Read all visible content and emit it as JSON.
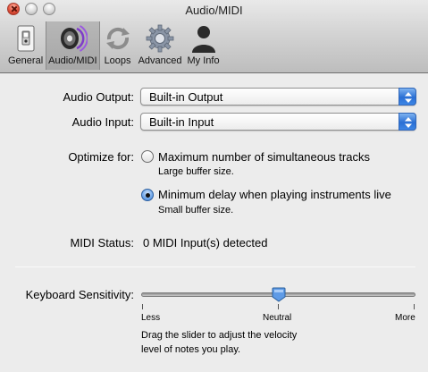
{
  "window": {
    "title": "Audio/MIDI"
  },
  "toolbar": {
    "items": [
      {
        "label": "General",
        "icon": "switch-icon",
        "selected": false
      },
      {
        "label": "Audio/MIDI",
        "icon": "speaker-icon",
        "selected": true
      },
      {
        "label": "Loops",
        "icon": "loops-icon",
        "selected": false
      },
      {
        "label": "Advanced",
        "icon": "gear-icon",
        "selected": false
      },
      {
        "label": "My Info",
        "icon": "person-icon",
        "selected": false
      }
    ]
  },
  "audio": {
    "output_label": "Audio Output:",
    "output_value": "Built-in Output",
    "input_label": "Audio Input:",
    "input_value": "Built-in Input"
  },
  "optimize": {
    "label": "Optimize for:",
    "options": [
      {
        "title": "Maximum number of simultaneous tracks",
        "subtitle": "Large buffer size.",
        "selected": false
      },
      {
        "title": "Minimum delay when playing instruments live",
        "subtitle": "Small buffer size.",
        "selected": true
      }
    ]
  },
  "midi": {
    "label": "MIDI Status:",
    "value": "0 MIDI Input(s) detected"
  },
  "keyboard": {
    "label": "Keyboard Sensitivity:",
    "value_fraction": 0.5,
    "min_label": "Less",
    "mid_label": "Neutral",
    "max_label": "More",
    "help_line1": "Drag the slider to adjust the velocity",
    "help_line2": "level of notes you play."
  },
  "colors": {
    "accent": "#3b7bd1",
    "window_bg": "#ececec"
  }
}
